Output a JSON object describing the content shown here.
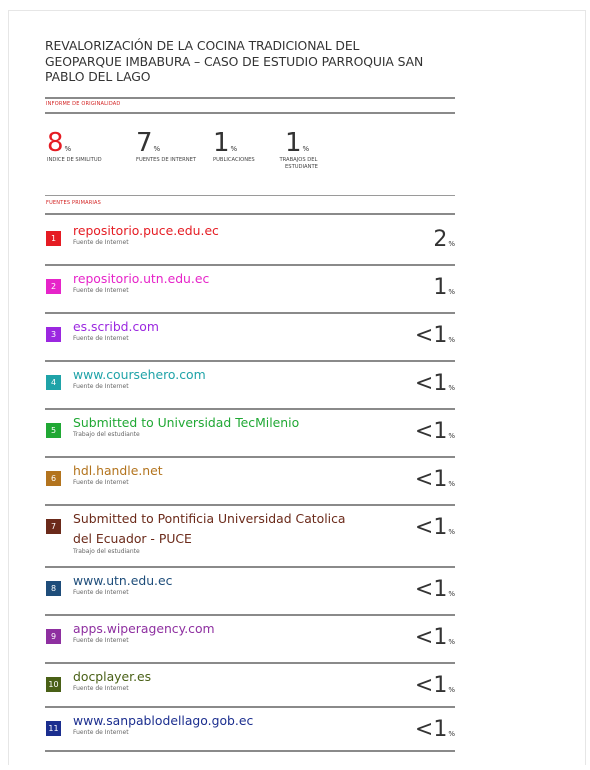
{
  "report": {
    "title_line1": "REVALORIZACIÓN DE LA COCINA TRADICIONAL DEL",
    "title_line2": "GEOPARQUE IMBABURA – CASO DE ESTUDIO PARROQUIA SAN",
    "title_line3": "PABLO DEL LAGO",
    "originality_label": "INFORME DE ORIGINALIDAD",
    "primary_sources_label": "FUENTES PRIMARIAS"
  },
  "stats": [
    {
      "value": "8",
      "unit": "%",
      "label": "INDICE DE SIMILITUD",
      "label2": "",
      "color": "#e51c23"
    },
    {
      "value": "7",
      "unit": "%",
      "label": "FUENTES DE INTERNET",
      "label2": ""
    },
    {
      "value": "1",
      "unit": "%",
      "label": "PUBLICACIONES",
      "label2": ""
    },
    {
      "value": "1",
      "unit": "%",
      "label": "TRABAJOS DEL",
      "label2": "ESTUDIANTE"
    }
  ],
  "sources": [
    {
      "num": "1",
      "name": "repositorio.puce.edu.ec",
      "name2": "",
      "type": "Fuente de Internet",
      "prefix": "",
      "value": "2",
      "unit": "%",
      "color": "#e51c23"
    },
    {
      "num": "2",
      "name": "repositorio.utn.edu.ec",
      "name2": "",
      "type": "Fuente de Internet",
      "prefix": "",
      "value": "1",
      "unit": "%",
      "color": "#e624c9"
    },
    {
      "num": "3",
      "name": "es.scribd.com",
      "name2": "",
      "type": "Fuente de Internet",
      "prefix": "<",
      "value": "1",
      "unit": "%",
      "color": "#9b27e0"
    },
    {
      "num": "4",
      "name": "www.coursehero.com",
      "name2": "",
      "type": "Fuente de Internet",
      "prefix": "<",
      "value": "1",
      "unit": "%",
      "color": "#1fa3a8"
    },
    {
      "num": "5",
      "name": "Submitted to Universidad TecMilenio",
      "name2": "",
      "type": "Trabajo del estudiante",
      "prefix": "<",
      "value": "1",
      "unit": "%",
      "color": "#20a834"
    },
    {
      "num": "6",
      "name": "hdl.handle.net",
      "name2": "",
      "type": "Fuente de Internet",
      "prefix": "<",
      "value": "1",
      "unit": "%",
      "color": "#b3741e"
    },
    {
      "num": "7",
      "name": "Submitted to Pontificia Universidad Catolica",
      "name2": "del Ecuador - PUCE",
      "type": "Trabajo del estudiante",
      "prefix": "<",
      "value": "1",
      "unit": "%",
      "color": "#6b2a1a"
    },
    {
      "num": "8",
      "name": "www.utn.edu.ec",
      "name2": "",
      "type": "Fuente de Internet",
      "prefix": "<",
      "value": "1",
      "unit": "%",
      "color": "#1e4d7a"
    },
    {
      "num": "9",
      "name": "apps.wiperagency.com",
      "name2": "",
      "type": "Fuente de Internet",
      "prefix": "<",
      "value": "1",
      "unit": "%",
      "color": "#8e2fa0"
    },
    {
      "num": "10",
      "name": "docplayer.es",
      "name2": "",
      "type": "Fuente de Internet",
      "prefix": "<",
      "value": "1",
      "unit": "%",
      "color": "#496016"
    },
    {
      "num": "11",
      "name": "www.sanpablodellago.gob.ec",
      "name2": "",
      "type": "Fuente de Internet",
      "prefix": "<",
      "value": "1",
      "unit": "%",
      "color": "#1b2e8f"
    }
  ]
}
